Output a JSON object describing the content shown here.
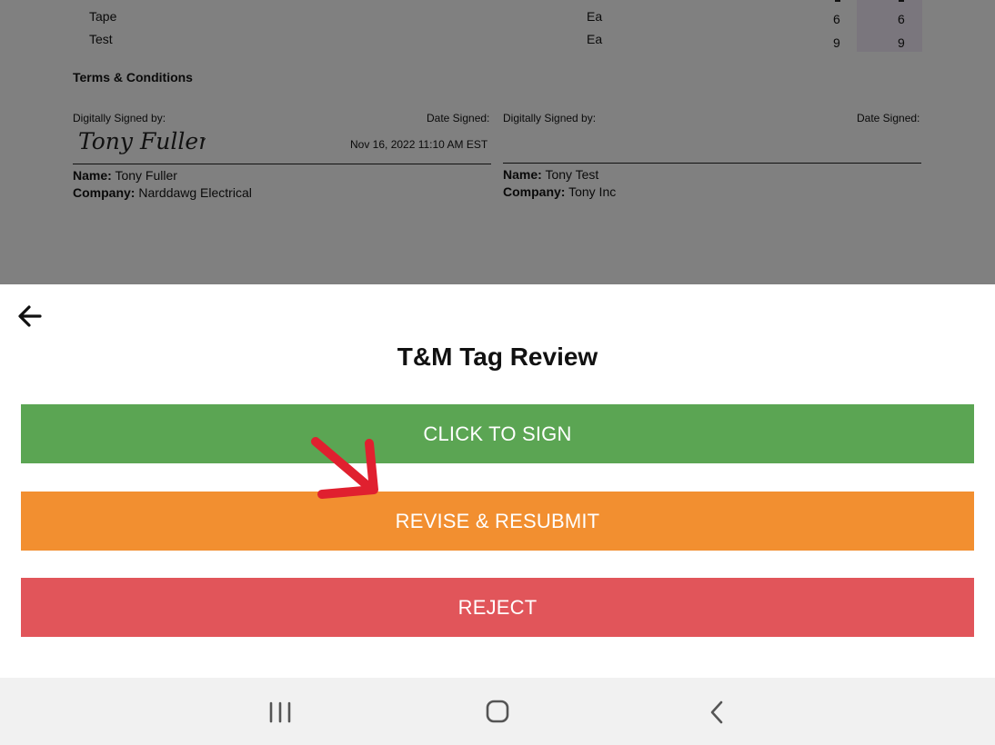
{
  "document": {
    "line_items": [
      {
        "name": "Tape",
        "unit": "Ea",
        "qty": "6",
        "qty2": "6"
      },
      {
        "name": "Test",
        "unit": "Ea",
        "qty": "9",
        "qty2": "9"
      }
    ],
    "terms_heading": "Terms & Conditions",
    "signature_left": {
      "signed_by_label": "Digitally Signed by:",
      "date_label": "Date Signed:",
      "date_value": "Nov 16, 2022 11:10 AM EST",
      "signature_text": "Tony Fuller",
      "name_label": "Name:",
      "name_value": "Tony Fuller",
      "company_label": "Company:",
      "company_value": "Narddawg Electrical"
    },
    "signature_right": {
      "signed_by_label": "Digitally Signed by:",
      "date_label": "Date Signed:",
      "name_label": "Name:",
      "name_value": "Tony Test",
      "company_label": "Company:",
      "company_value": "Tony Inc"
    }
  },
  "sheet": {
    "title": "T&M Tag Review",
    "buttons": {
      "sign": "CLICK TO SIGN",
      "revise": "REVISE & RESUBMIT",
      "reject": "REJECT"
    }
  },
  "colors": {
    "sign": "#5ba553",
    "revise": "#f28f30",
    "reject": "#e1555a",
    "annotation_arrow": "#e0202f"
  },
  "icons": {
    "back": "arrow-left-icon",
    "recents": "recent-apps-icon",
    "home": "home-icon",
    "nav_back": "chevron-left-icon"
  }
}
